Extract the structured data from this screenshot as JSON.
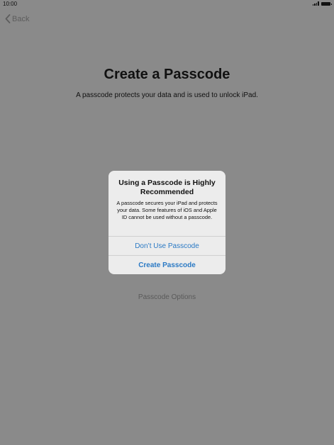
{
  "status_bar": {
    "time": "10:00",
    "signal_icon": "cellular-signal-icon",
    "battery_icon": "battery-icon"
  },
  "nav": {
    "back_label": "Back",
    "back_icon": "chevron-left-icon"
  },
  "main": {
    "title": "Create a Passcode",
    "subtitle": "A passcode protects your data and is used to unlock iPad.",
    "options_link": "Passcode Options"
  },
  "dialog": {
    "title": "Using a Passcode is Highly Recommended",
    "message": "A passcode secures your iPad and protects your data. Some features of iOS and Apple ID cannot be used without a passcode.",
    "buttons": [
      {
        "label": "Don’t Use Passcode"
      },
      {
        "label": "Create Passcode"
      }
    ]
  },
  "colors": {
    "background": "#8a8a8a",
    "dialog_background": "#ececec",
    "link_blue": "#2a79c4"
  }
}
